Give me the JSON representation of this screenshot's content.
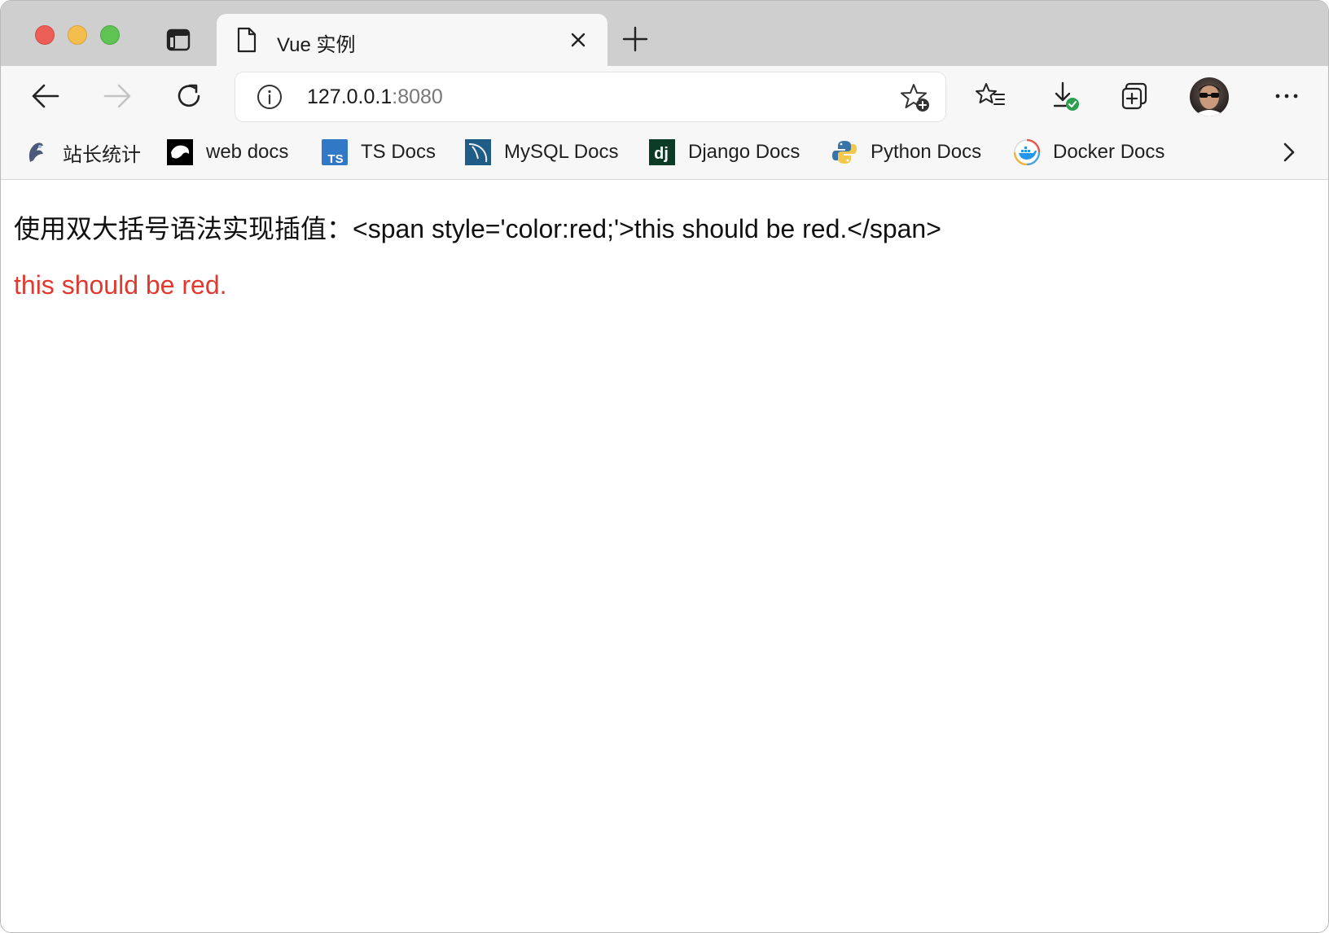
{
  "tab": {
    "title": "Vue 实例"
  },
  "address_bar": {
    "host": "127.0.0.1",
    "port": ":8080"
  },
  "bookmarks": [
    {
      "label": "站长统计",
      "icon": "cnzz-icon"
    },
    {
      "label": "web docs",
      "icon": "mdn-icon"
    },
    {
      "label": "TS Docs",
      "icon": "typescript-icon"
    },
    {
      "label": "MySQL Docs",
      "icon": "mysql-icon"
    },
    {
      "label": "Django Docs",
      "icon": "django-icon"
    },
    {
      "label": "Python Docs",
      "icon": "python-icon"
    },
    {
      "label": "Docker Docs",
      "icon": "docker-icon"
    }
  ],
  "page": {
    "line1": "使用双大括号语法实现插值：<span style='color:red;'>this should be red.</span>",
    "line2": "this should be red.",
    "line2_color": "#e03a2f"
  },
  "colors": {
    "tabstrip": "#cfcfcf",
    "toolbar": "#f7f7f7",
    "download_check": "#2e9e4f"
  }
}
